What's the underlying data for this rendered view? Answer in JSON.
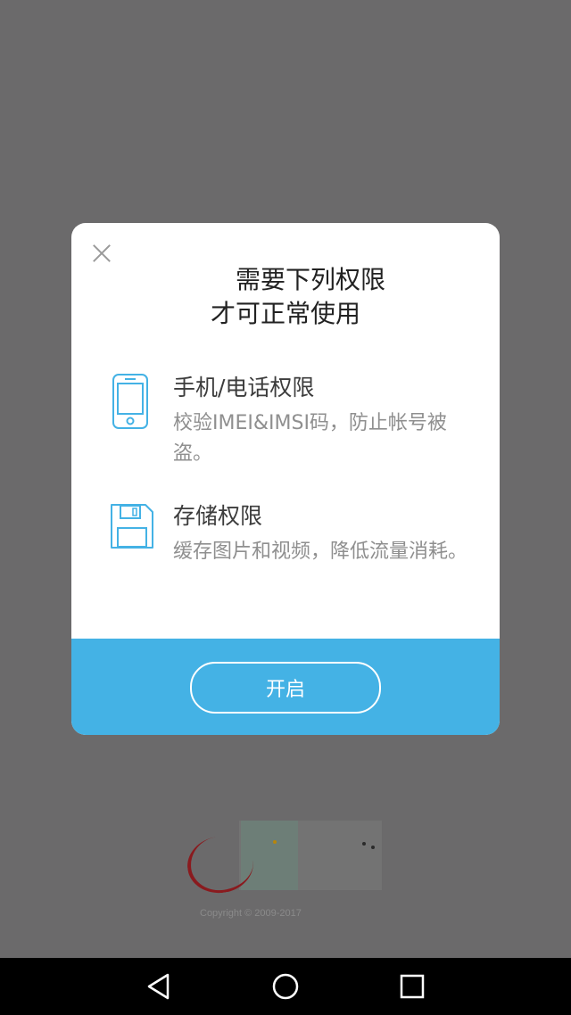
{
  "background": {
    "overlay_color": "#6b6a6b",
    "copyright": "Copyright © 2009-2017"
  },
  "dialog": {
    "title_line1": "需要下列权限",
    "title_line2": "才可正常使用",
    "permissions": [
      {
        "icon": "phone-icon",
        "title": "手机/电话权限",
        "description": "校验IMEI&IMSI码，防止帐号被盗。"
      },
      {
        "icon": "floppy-disk-icon",
        "title": "存储权限",
        "description": "缓存图片和视频，降低流量消耗。"
      }
    ],
    "button_label": "开启",
    "accent_color": "#44b2e5"
  },
  "navbar": {
    "buttons": [
      "back",
      "home",
      "recents"
    ]
  }
}
